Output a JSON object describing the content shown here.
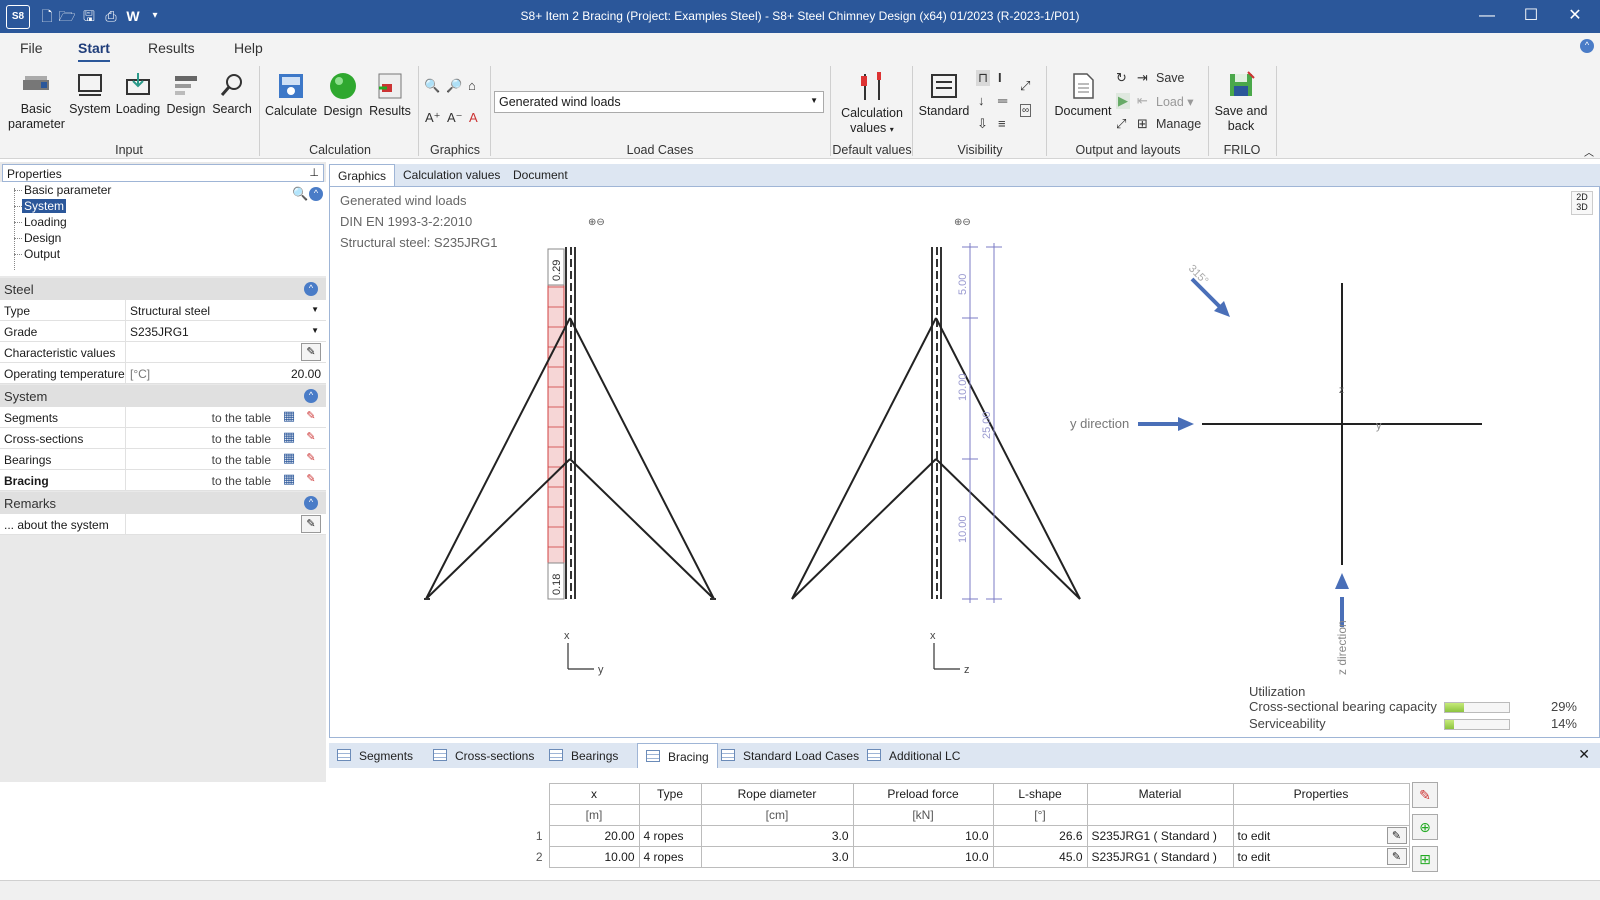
{
  "titlebar": {
    "app_logo": "S8",
    "title": "S8+ Item 2 Bracing (Project: Examples Steel) - S8+ Steel Chimney Design (x64) 01/2023 (R-2023-1/P01)",
    "quick_access": [
      "new-file-icon",
      "open-folder-icon",
      "save-icon",
      "print-icon",
      "word-icon",
      "dropdown-icon"
    ],
    "quick_access_w": "W"
  },
  "menu": {
    "tabs": [
      "File",
      "Start",
      "Results",
      "Help"
    ],
    "active": "Start"
  },
  "ribbon": {
    "input": {
      "label": "Input",
      "buttons": [
        "Basic parameter",
        "System",
        "Loading",
        "Design",
        "Search"
      ]
    },
    "calculation": {
      "label": "Calculation",
      "buttons": [
        "Calculate",
        "Design",
        "Results"
      ]
    },
    "graphics": {
      "label": "Graphics"
    },
    "load_cases": {
      "label": "Load Cases",
      "selected": "Generated wind loads"
    },
    "default_values": {
      "label": "Default values",
      "button": "Calculation values"
    },
    "visibility": {
      "label": "Visibility",
      "button": "Standard"
    },
    "output": {
      "label": "Output and layouts",
      "document": "Document",
      "save": "Save",
      "load": "Load",
      "manage": "Manage"
    },
    "frilo": {
      "label": "FRILO",
      "button": "Save and back"
    }
  },
  "properties": {
    "header": "Properties",
    "tree": [
      "Basic parameter",
      "System",
      "Loading",
      "Design",
      "Output"
    ],
    "tree_selected": "System",
    "steel": {
      "title": "Steel",
      "type_label": "Type",
      "type_value": "Structural steel",
      "grade_label": "Grade",
      "grade_value": "S235JRG1",
      "char_label": "Characteristic values",
      "temp_label": "Operating temperature",
      "temp_unit": "[°C]",
      "temp_value": "20.00"
    },
    "system": {
      "title": "System",
      "rows": [
        "Segments",
        "Cross-sections",
        "Bearings",
        "Bracing"
      ],
      "link_text": "to the table"
    },
    "remarks": {
      "title": "Remarks",
      "about": "... about the system"
    }
  },
  "view_tabs": [
    "Graphics",
    "Calculation values",
    "Document"
  ],
  "graphics": {
    "info": [
      "Generated wind loads",
      "DIN EN 1993-3-2:2010",
      "Structural steel: S235JRG1"
    ],
    "toggle": "2D\n3D",
    "left_view": {
      "top_load": "0.29",
      "bottom_load": "0.18",
      "axis_x": "x",
      "axis_y": "y"
    },
    "mid_view": {
      "dim_top": "5.00",
      "dim_mid": "10.00",
      "dim_total": "25.00",
      "dim_bot": "10.00",
      "axis_x": "x",
      "axis_z": "z"
    },
    "plan_view": {
      "angle": "315°",
      "y_direction": "y direction",
      "z_direction": "z direction",
      "axis_y": "y",
      "axis_z": "z"
    },
    "utilization": {
      "title": "Utilization",
      "items": [
        {
          "label": "Cross-sectional bearing capacity",
          "value": 0.29,
          "text": "29%"
        },
        {
          "label": "Serviceability",
          "value": 0.14,
          "text": "14%"
        }
      ]
    }
  },
  "bottom_tabs": [
    "Segments",
    "Cross-sections",
    "Bearings",
    "Bracing",
    "Standard Load Cases",
    "Additional LC"
  ],
  "bottom_active": "Bracing",
  "bracing_table": {
    "headers": [
      "x",
      "Type",
      "Rope diameter",
      "Preload force",
      "L-shape",
      "Material",
      "Properties"
    ],
    "units": [
      "[m]",
      "",
      "[cm]",
      "[kN]",
      "[°]",
      "",
      ""
    ],
    "rows": [
      {
        "n": "1",
        "x": "20.00",
        "type": "4 ropes",
        "rope": "3.0",
        "preload": "10.0",
        "lshape": "26.6",
        "material": "S235JRG1 ( Standard )",
        "props": "to edit"
      },
      {
        "n": "2",
        "x": "10.00",
        "type": "4 ropes",
        "rope": "3.0",
        "preload": "10.0",
        "lshape": "45.0",
        "material": "S235JRG1 ( Standard )",
        "props": "to edit"
      }
    ]
  },
  "colors": {
    "title_bar": "#2b579a",
    "load_fill": "#f6d6d6",
    "load_line": "#d04040",
    "arrow": "#4a6fb8",
    "dim": "#7b7bc4"
  }
}
